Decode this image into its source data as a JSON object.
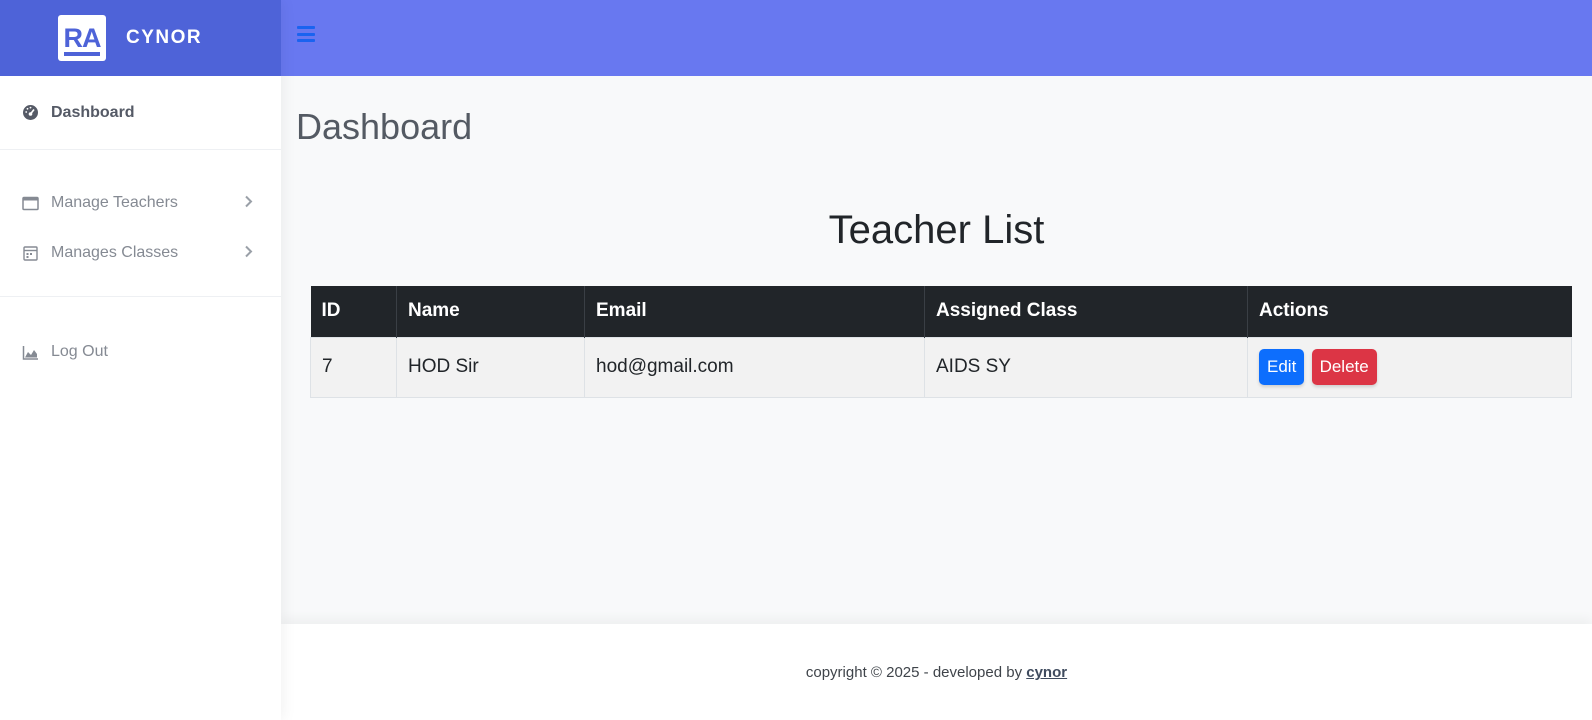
{
  "brand": {
    "logo_text": "RA",
    "name": "CYNOR"
  },
  "sidebar": {
    "dashboard": {
      "label": "Dashboard",
      "icon": "gauge-icon"
    },
    "items": [
      {
        "label": "Manage Teachers",
        "icon": "window-icon"
      },
      {
        "label": "Manages Classes",
        "icon": "calendar-icon"
      }
    ],
    "logout": {
      "label": "Log Out",
      "icon": "area-chart-icon"
    }
  },
  "topbar": {
    "menu_icon": "hamburger-icon"
  },
  "main": {
    "page_title": "Dashboard",
    "section_title": "Teacher List"
  },
  "table": {
    "headers": [
      "ID",
      "Name",
      "Email",
      "Assigned Class",
      "Actions"
    ],
    "rows": [
      {
        "id": "7",
        "name": "HOD Sir",
        "email": "hod@gmail.com",
        "assigned_class": "AIDS SY",
        "edit_label": "Edit",
        "delete_label": "Delete"
      }
    ]
  },
  "footer": {
    "prefix": "copyright © 2025 - developed by",
    "link": "cynor"
  },
  "colors": {
    "brand_bg": "#4e63d8",
    "topbar_bg": "#6878f0",
    "table_header_bg": "#212529",
    "edit_button": "#0d6efd",
    "delete_button": "#dc3545"
  }
}
